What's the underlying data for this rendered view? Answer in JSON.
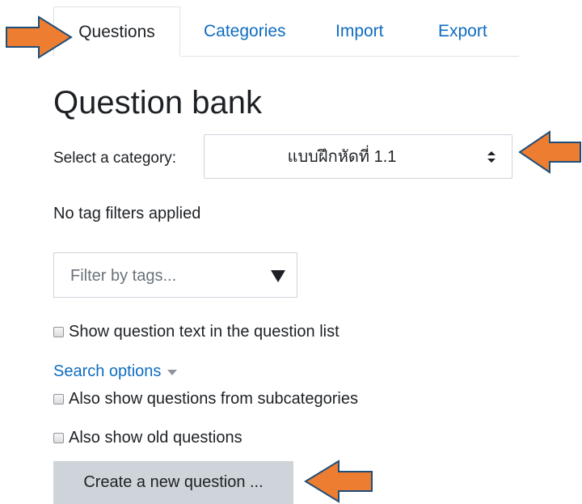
{
  "tabs": [
    {
      "label": "Questions",
      "active": true
    },
    {
      "label": "Categories",
      "active": false
    },
    {
      "label": "Import",
      "active": false
    },
    {
      "label": "Export",
      "active": false
    }
  ],
  "page_title": "Question bank",
  "category": {
    "label": "Select a category:",
    "selected": "แบบฝึกหัดที่ 1.1"
  },
  "tag_status": "No tag filters applied",
  "tag_filter": {
    "placeholder": "Filter by tags..."
  },
  "options": {
    "show_question_text": "Show question text in the question list",
    "search_options": "Search options",
    "subcategories": "Also show questions from subcategories",
    "old_questions": "Also show old questions"
  },
  "create_button": "Create a new question ...",
  "colors": {
    "link": "#0f6cbf",
    "arrow_fill": "#ed7d31",
    "arrow_stroke": "#1f4e79",
    "button_bg": "#ced4da"
  }
}
